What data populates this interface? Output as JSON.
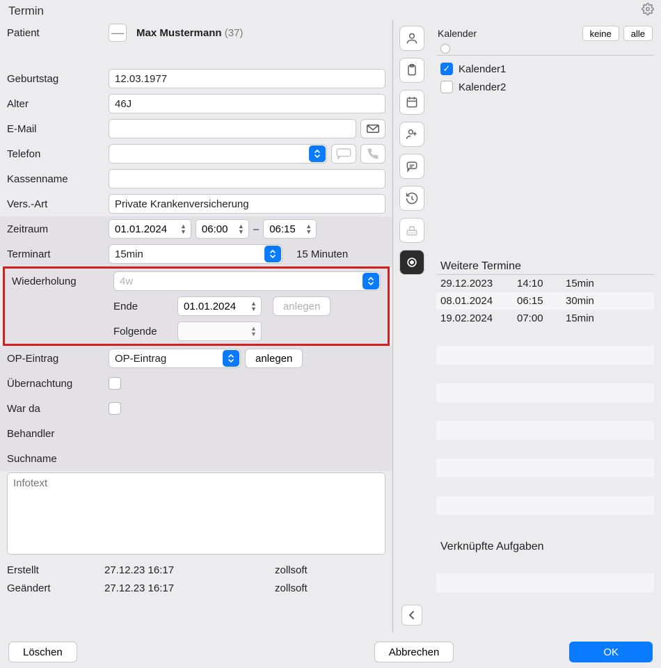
{
  "window": {
    "title": "Termin"
  },
  "labels": {
    "patient": "Patient",
    "birthday": "Geburtstag",
    "age": "Alter",
    "email": "E-Mail",
    "phone": "Telefon",
    "insurance_name": "Kassenname",
    "insurance_type": "Vers.-Art",
    "timeslot": "Zeitraum",
    "appointment_type": "Terminart",
    "repeat": "Wiederholung",
    "repeat_end": "Ende",
    "repeat_following": "Folgende",
    "op_entry": "OP-Eintrag",
    "overnight": "Übernachtung",
    "was_there": "War da",
    "practitioner": "Behandler",
    "searchname": "Suchname",
    "created": "Erstellt",
    "modified": "Geändert",
    "more_appointments": "Weitere Termine",
    "linked_tasks": "Verknüpfte Aufgaben",
    "calendar": "Kalender"
  },
  "buttons": {
    "create": "anlegen",
    "create_disabled": "anlegen",
    "delete": "Löschen",
    "cancel": "Abbrechen",
    "ok": "OK",
    "none": "keine",
    "all": "alle"
  },
  "patient": {
    "name": "Max Mustermann",
    "age_suffix": "(37)",
    "birthday": "12.03.1977",
    "age": "46J",
    "email": "",
    "phone": "",
    "insurance_name": "",
    "insurance_type": "Private Krankenversicherung"
  },
  "timeslot": {
    "date": "01.01.2024",
    "start": "06:00",
    "dash": "–",
    "end": "06:15"
  },
  "appointment_type": {
    "value": "15min",
    "duration_label": "15 Minuten"
  },
  "repeat": {
    "placeholder": "4w",
    "end_date": "01.01.2024",
    "following": ""
  },
  "op_entry": {
    "value": "OP-Eintrag"
  },
  "infotext_placeholder": "Infotext",
  "meta": {
    "created_at": "27.12.23 16:17",
    "created_by": "zollsoft",
    "modified_at": "27.12.23 16:17",
    "modified_by": "zollsoft"
  },
  "calendars": [
    {
      "name": "Kalender1",
      "checked": true
    },
    {
      "name": "Kalender2",
      "checked": false
    }
  ],
  "more_appointments": [
    {
      "date": "29.12.2023",
      "time": "14:10",
      "kind": "15min"
    },
    {
      "date": "08.01.2024",
      "time": "06:15",
      "kind": "30min"
    },
    {
      "date": "19.02.2024",
      "time": "07:00",
      "kind": "15min"
    }
  ]
}
